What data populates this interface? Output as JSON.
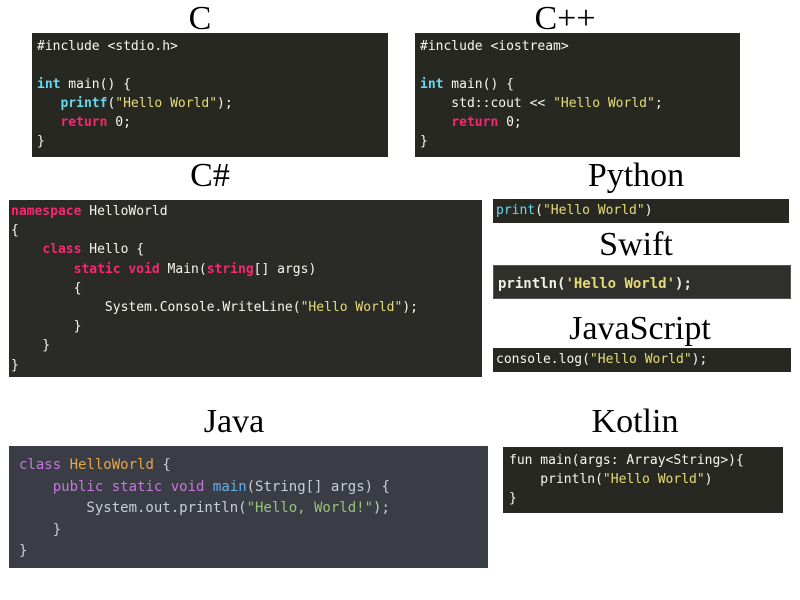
{
  "snippets": {
    "c": {
      "title": "C",
      "lines": [
        [
          {
            "t": "#include <stdio.h>",
            "c": "plain"
          }
        ],
        [
          {
            "t": "",
            "c": "plain"
          }
        ],
        [
          {
            "t": "int",
            "c": "ty"
          },
          {
            "t": " main() {",
            "c": "plain"
          }
        ],
        [
          {
            "t": "   ",
            "c": "plain"
          },
          {
            "t": "printf",
            "c": "ty"
          },
          {
            "t": "(",
            "c": "plain"
          },
          {
            "t": "\"Hello World\"",
            "c": "str"
          },
          {
            "t": ");",
            "c": "plain"
          }
        ],
        [
          {
            "t": "   ",
            "c": "plain"
          },
          {
            "t": "return",
            "c": "kw"
          },
          {
            "t": " 0;",
            "c": "plain"
          }
        ],
        [
          {
            "t": "}",
            "c": "plain"
          }
        ]
      ]
    },
    "cpp": {
      "title": "C++",
      "lines": [
        [
          {
            "t": "#include <iostream>",
            "c": "plain"
          }
        ],
        [
          {
            "t": "",
            "c": "plain"
          }
        ],
        [
          {
            "t": "int",
            "c": "ty"
          },
          {
            "t": " main() {",
            "c": "plain"
          }
        ],
        [
          {
            "t": "    std::cout << ",
            "c": "plain"
          },
          {
            "t": "\"Hello World\"",
            "c": "str"
          },
          {
            "t": ";",
            "c": "plain"
          }
        ],
        [
          {
            "t": "    ",
            "c": "plain"
          },
          {
            "t": "return",
            "c": "kw"
          },
          {
            "t": " 0;",
            "c": "plain"
          }
        ],
        [
          {
            "t": "}",
            "c": "plain"
          }
        ]
      ]
    },
    "csharp": {
      "title": "C#",
      "lines": [
        [
          {
            "t": "namespace",
            "c": "kw"
          },
          {
            "t": " HelloWorld",
            "c": "plain"
          }
        ],
        [
          {
            "t": "{",
            "c": "plain"
          }
        ],
        [
          {
            "t": "    ",
            "c": "plain"
          },
          {
            "t": "class",
            "c": "kw"
          },
          {
            "t": " Hello {",
            "c": "plain"
          }
        ],
        [
          {
            "t": "        ",
            "c": "plain"
          },
          {
            "t": "static",
            "c": "kw"
          },
          {
            "t": " ",
            "c": "plain"
          },
          {
            "t": "void",
            "c": "kw"
          },
          {
            "t": " Main(",
            "c": "plain"
          },
          {
            "t": "string",
            "c": "kw"
          },
          {
            "t": "[] args)",
            "c": "plain"
          }
        ],
        [
          {
            "t": "        {",
            "c": "plain"
          }
        ],
        [
          {
            "t": "            System.Console.WriteLine(",
            "c": "plain"
          },
          {
            "t": "\"Hello World\"",
            "c": "str"
          },
          {
            "t": ");",
            "c": "plain"
          }
        ],
        [
          {
            "t": "        }",
            "c": "plain"
          }
        ],
        [
          {
            "t": "    }",
            "c": "plain"
          }
        ],
        [
          {
            "t": "}",
            "c": "plain"
          }
        ]
      ]
    },
    "python": {
      "title": "Python",
      "lines": [
        [
          {
            "t": "print",
            "c": "fn"
          },
          {
            "t": "(",
            "c": "plain"
          },
          {
            "t": "\"Hello World\"",
            "c": "str"
          },
          {
            "t": ")",
            "c": "plain"
          }
        ]
      ]
    },
    "swift": {
      "title": "Swift",
      "lines": [
        [
          {
            "t": "println(",
            "c": "sw-plain"
          },
          {
            "t": "'Hello World'",
            "c": "sw-str"
          },
          {
            "t": ");",
            "c": "sw-plain"
          }
        ]
      ]
    },
    "javascript": {
      "title": "JavaScript",
      "lines": [
        [
          {
            "t": "console.log(",
            "c": "plain"
          },
          {
            "t": "\"Hello World\"",
            "c": "str"
          },
          {
            "t": ");",
            "c": "plain"
          }
        ]
      ]
    },
    "java": {
      "title": "Java",
      "lines": [
        [
          {
            "t": "class",
            "c": "jkw"
          },
          {
            "t": " ",
            "c": "jplain"
          },
          {
            "t": "HelloWorld",
            "c": "jcls"
          },
          {
            "t": " {",
            "c": "jplain"
          }
        ],
        [
          {
            "t": "    ",
            "c": "jplain"
          },
          {
            "t": "public",
            "c": "jkw"
          },
          {
            "t": " ",
            "c": "jplain"
          },
          {
            "t": "static",
            "c": "jkw"
          },
          {
            "t": " ",
            "c": "jplain"
          },
          {
            "t": "void",
            "c": "jkw"
          },
          {
            "t": " ",
            "c": "jplain"
          },
          {
            "t": "main",
            "c": "jfn"
          },
          {
            "t": "(String[] args) {",
            "c": "jplain"
          }
        ],
        [
          {
            "t": "        System.out.println(",
            "c": "jplain"
          },
          {
            "t": "\"Hello, World!\"",
            "c": "jstr"
          },
          {
            "t": ");",
            "c": "jplain"
          }
        ],
        [
          {
            "t": "    }",
            "c": "jplain"
          }
        ],
        [
          {
            "t": "}",
            "c": "jplain"
          }
        ]
      ]
    },
    "kotlin": {
      "title": "Kotlin",
      "lines": [
        [
          {
            "t": "fun main(args: Array<String>){",
            "c": "plain"
          }
        ],
        [
          {
            "t": "    println(",
            "c": "plain"
          },
          {
            "t": "\"Hello World\"",
            "c": "str"
          },
          {
            "t": ")",
            "c": "plain"
          }
        ],
        [
          {
            "t": "}",
            "c": "plain"
          }
        ]
      ]
    }
  }
}
